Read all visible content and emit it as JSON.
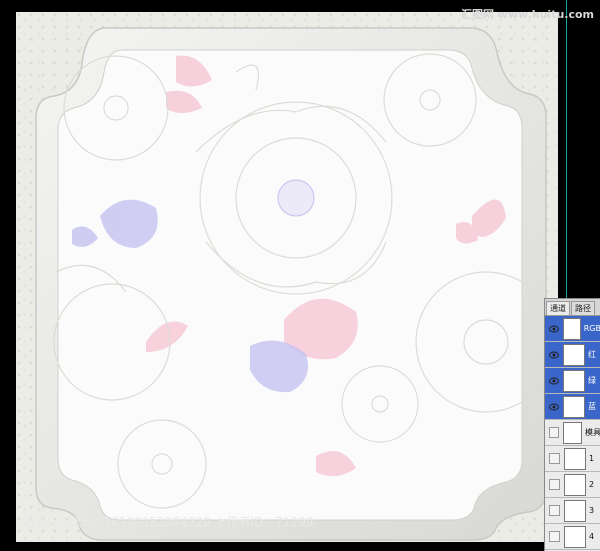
{
  "watermark": {
    "top": "汇图网 www.huitu.com",
    "bottom": "编号：20150818100152364320 上传者ID：71299"
  },
  "channels_panel": {
    "tabs": [
      "通道",
      "路径"
    ],
    "channels": [
      {
        "label": "RGB",
        "visible": true,
        "selected": true
      },
      {
        "label": "红",
        "visible": true,
        "selected": true
      },
      {
        "label": "绿",
        "visible": true,
        "selected": true
      },
      {
        "label": "蓝",
        "visible": true,
        "selected": true
      },
      {
        "label": "模具",
        "visible": false,
        "selected": false
      },
      {
        "label": "1",
        "visible": false,
        "selected": false
      },
      {
        "label": "2",
        "visible": false,
        "selected": false
      },
      {
        "label": "3",
        "visible": false,
        "selected": false
      },
      {
        "label": "4",
        "visible": false,
        "selected": false
      }
    ]
  },
  "colors": {
    "background": "#000000",
    "paper": "#ecece6",
    "selection": "#3a66c9",
    "guide": "#1aa4a4",
    "pink_petal": "#f6c9d6",
    "lavender_petal": "#c9c6f2"
  }
}
